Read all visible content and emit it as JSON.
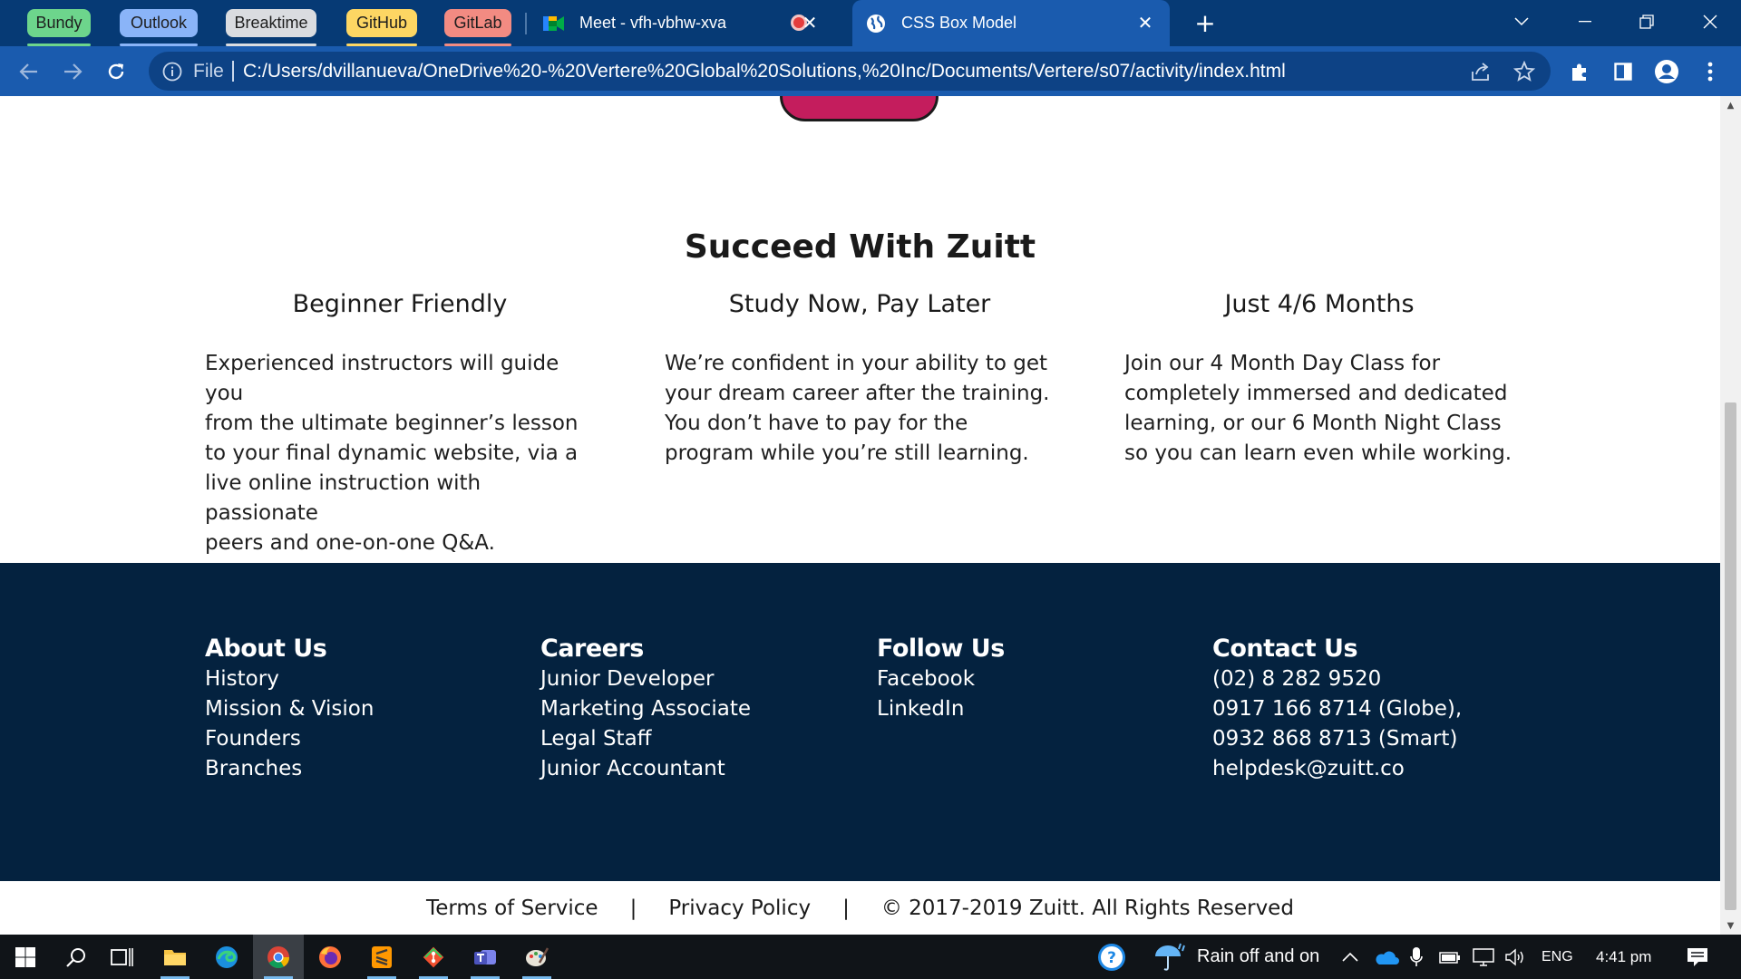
{
  "browser": {
    "tab_groups": [
      {
        "label": "Bundy",
        "color": "#6dd58c"
      },
      {
        "label": "Outlook",
        "color": "#8ab4f8"
      },
      {
        "label": "Breaktime",
        "color": "#dadce0"
      },
      {
        "label": "GitHub",
        "color": "#fdd663"
      },
      {
        "label": "GitLab",
        "color": "#f28b82"
      }
    ],
    "tabs": [
      {
        "title": "Meet - vfh-vbhw-xva",
        "icon": "google-meet-icon",
        "recording": true
      },
      {
        "title": "CSS Box Model",
        "icon": "globe-icon",
        "active": true
      }
    ],
    "omnibox": {
      "scheme_label": "File",
      "url": "C:/Users/dvillanueva/OneDrive%20-%20Vertere%20Global%20Solutions,%20Inc/Documents/Vertere/s07/activity/index.html"
    }
  },
  "page": {
    "section_title": "Succeed With Zuitt",
    "features": [
      {
        "title": "Beginner Friendly",
        "lines": [
          "Experienced instructors will guide you",
          "from the ultimate beginner’s lesson",
          "to your final dynamic website, via a",
          "live online instruction with passionate",
          "peers and one-on-one Q&A."
        ]
      },
      {
        "title": "Study Now, Pay Later",
        "lines": [
          "We’re confident in your ability to get",
          "your dream career after the training.",
          "You don’t have to pay for the",
          "program while you’re still learning."
        ]
      },
      {
        "title": "Just 4/6 Months",
        "lines": [
          "Join our 4 Month Day Class for",
          "completely immersed and dedicated",
          "learning, or our 6 Month Night Class",
          "so you can learn even while working."
        ]
      }
    ],
    "footer": {
      "columns": [
        {
          "heading": "About Us",
          "items": [
            "History",
            "Mission & Vision",
            "Founders",
            "Branches"
          ]
        },
        {
          "heading": "Careers",
          "items": [
            "Junior Developer",
            "Marketing Associate",
            "Legal Staff",
            "Junior Accountant"
          ]
        },
        {
          "heading": "Follow Us",
          "items": [
            "Facebook",
            "LinkedIn"
          ]
        },
        {
          "heading": "Contact Us",
          "items": [
            "(02) 8 282 9520",
            "0917 166 8714 (Globe),",
            "0932 868 8713 (Smart)",
            "helpdesk@zuitt.co"
          ]
        }
      ]
    },
    "legal": {
      "terms": "Terms of Service",
      "separator": "|",
      "privacy": "Privacy Policy",
      "copyright": "© 2017-2019 Zuitt. All Rights Reserved"
    }
  },
  "taskbar": {
    "weather": "Rain off and on",
    "language": "ENG",
    "time": "4:41 pm"
  },
  "colors": {
    "tabstrip": "#063a75",
    "toolbar": "#1a5bae",
    "footer_bg": "#04223f",
    "hero_button": "#c41d5d"
  }
}
